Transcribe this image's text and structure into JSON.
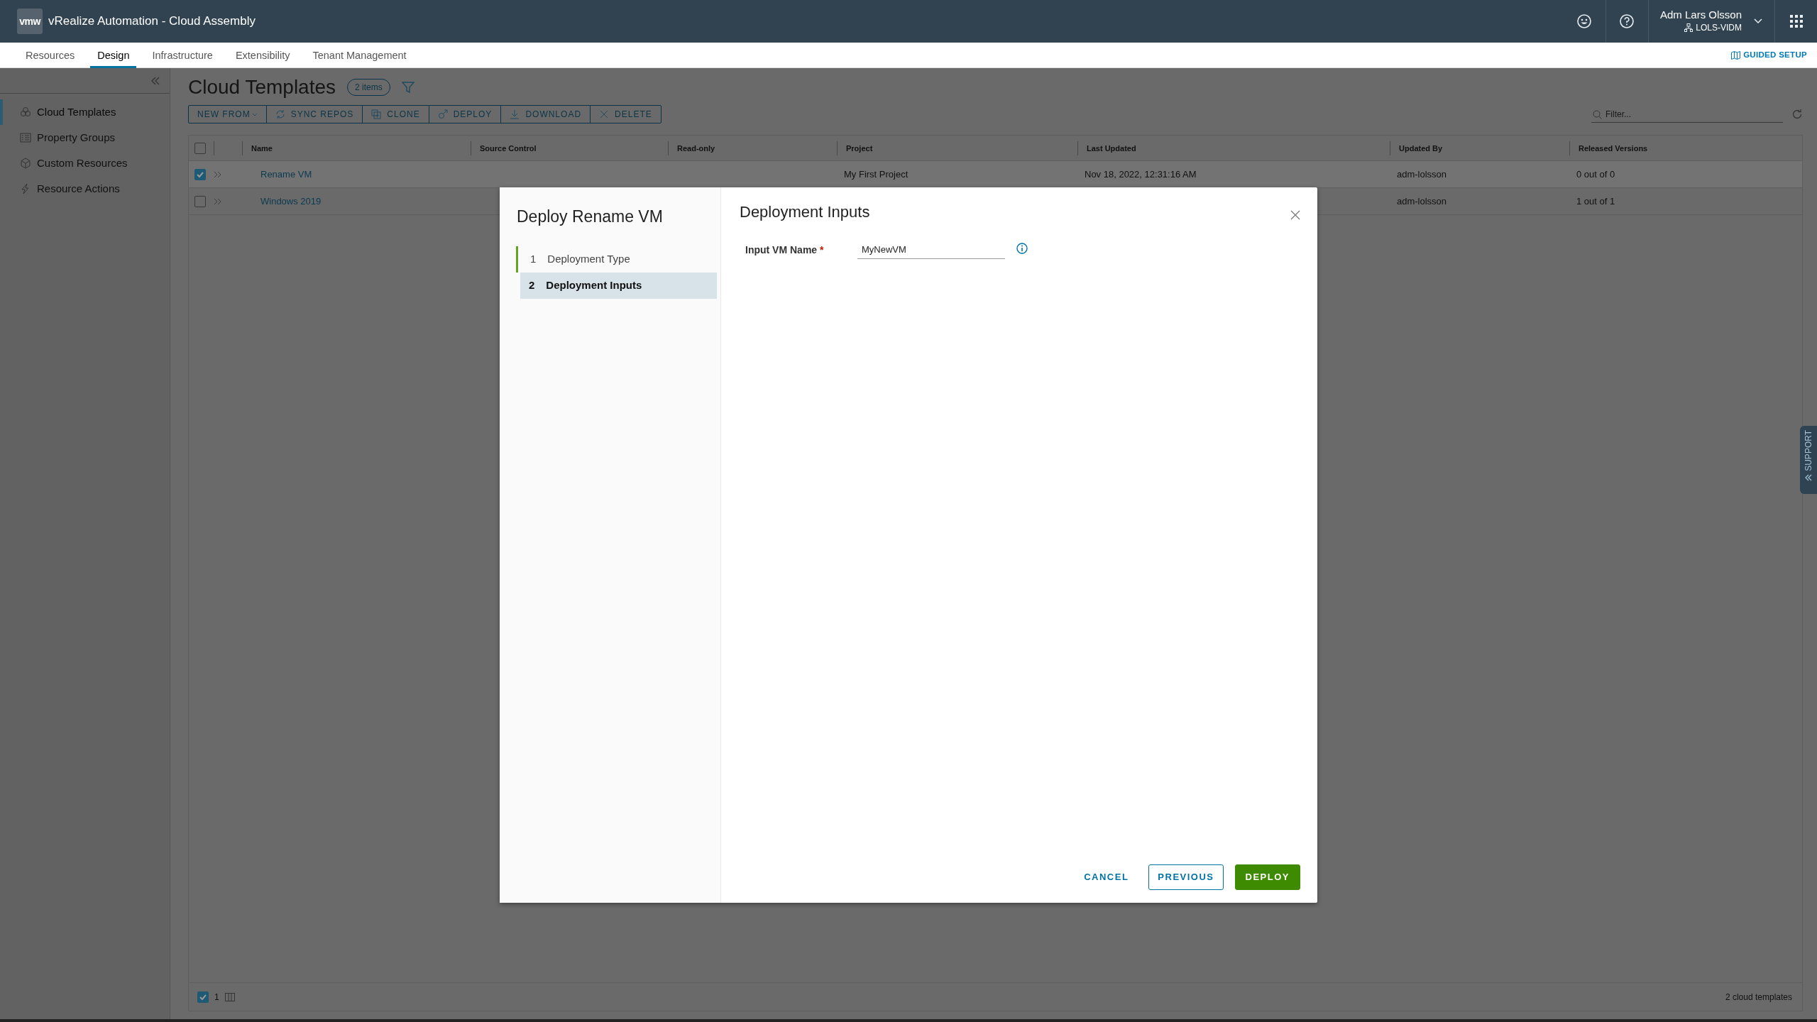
{
  "header": {
    "logo": "vmw",
    "title": "vRealize Automation - Cloud Assembly",
    "user": {
      "name": "Adm Lars Olsson",
      "org": "LOLS-VIDM"
    }
  },
  "nav_tabs": [
    {
      "label": "Resources",
      "selected": false
    },
    {
      "label": "Design",
      "selected": true
    },
    {
      "label": "Infrastructure",
      "selected": false
    },
    {
      "label": "Extensibility",
      "selected": false
    },
    {
      "label": "Tenant Management",
      "selected": false
    }
  ],
  "guided_setup": "GUIDED SETUP",
  "sidebar": {
    "items": [
      {
        "label": "Cloud Templates",
        "selected": true
      },
      {
        "label": "Property Groups",
        "selected": false
      },
      {
        "label": "Custom Resources",
        "selected": false
      },
      {
        "label": "Resource Actions",
        "selected": false
      }
    ]
  },
  "page": {
    "title": "Cloud Templates",
    "count": "2 items",
    "filter": {
      "placeholder": "Filter..."
    },
    "toolbar": [
      "NEW FROM",
      "SYNC REPOS",
      "CLONE",
      "DEPLOY",
      "DOWNLOAD",
      "DELETE"
    ]
  },
  "table": {
    "all_selected": false,
    "columns": [
      "Name",
      "Source Control",
      "Read-only",
      "Project",
      "Last Updated",
      "Updated By",
      "Released Versions"
    ],
    "rows": [
      {
        "selected": true,
        "name": "Rename VM",
        "project": "My First Project",
        "last_updated": "Nov 18, 2022, 12:31:16 AM",
        "updated_by": "adm-lolsson",
        "released_versions": "0 out of 0"
      },
      {
        "selected": false,
        "name": "Windows 2019",
        "updated_by": "adm-lolsson",
        "released_versions": "1 out of 1"
      }
    ],
    "footer": {
      "checked": true,
      "selected_count": "1",
      "total": "2 cloud templates"
    }
  },
  "modal": {
    "title": "Deploy Rename VM",
    "heading": "Deployment Inputs",
    "steps": [
      {
        "number": "1",
        "label": "Deployment Type",
        "completed": true,
        "selected": false
      },
      {
        "number": "2",
        "label": "Deployment Inputs",
        "completed": false,
        "selected": true
      }
    ],
    "fields": [
      {
        "label": "Input VM Name",
        "required_mark": "*",
        "value": "MyNewVM"
      }
    ],
    "buttons": [
      {
        "label": "CANCEL",
        "kind": "link"
      },
      {
        "label": "PREVIOUS",
        "kind": "outline"
      },
      {
        "label": "DEPLOY",
        "kind": "primary"
      }
    ]
  },
  "support_tab": "SUPPORT"
}
